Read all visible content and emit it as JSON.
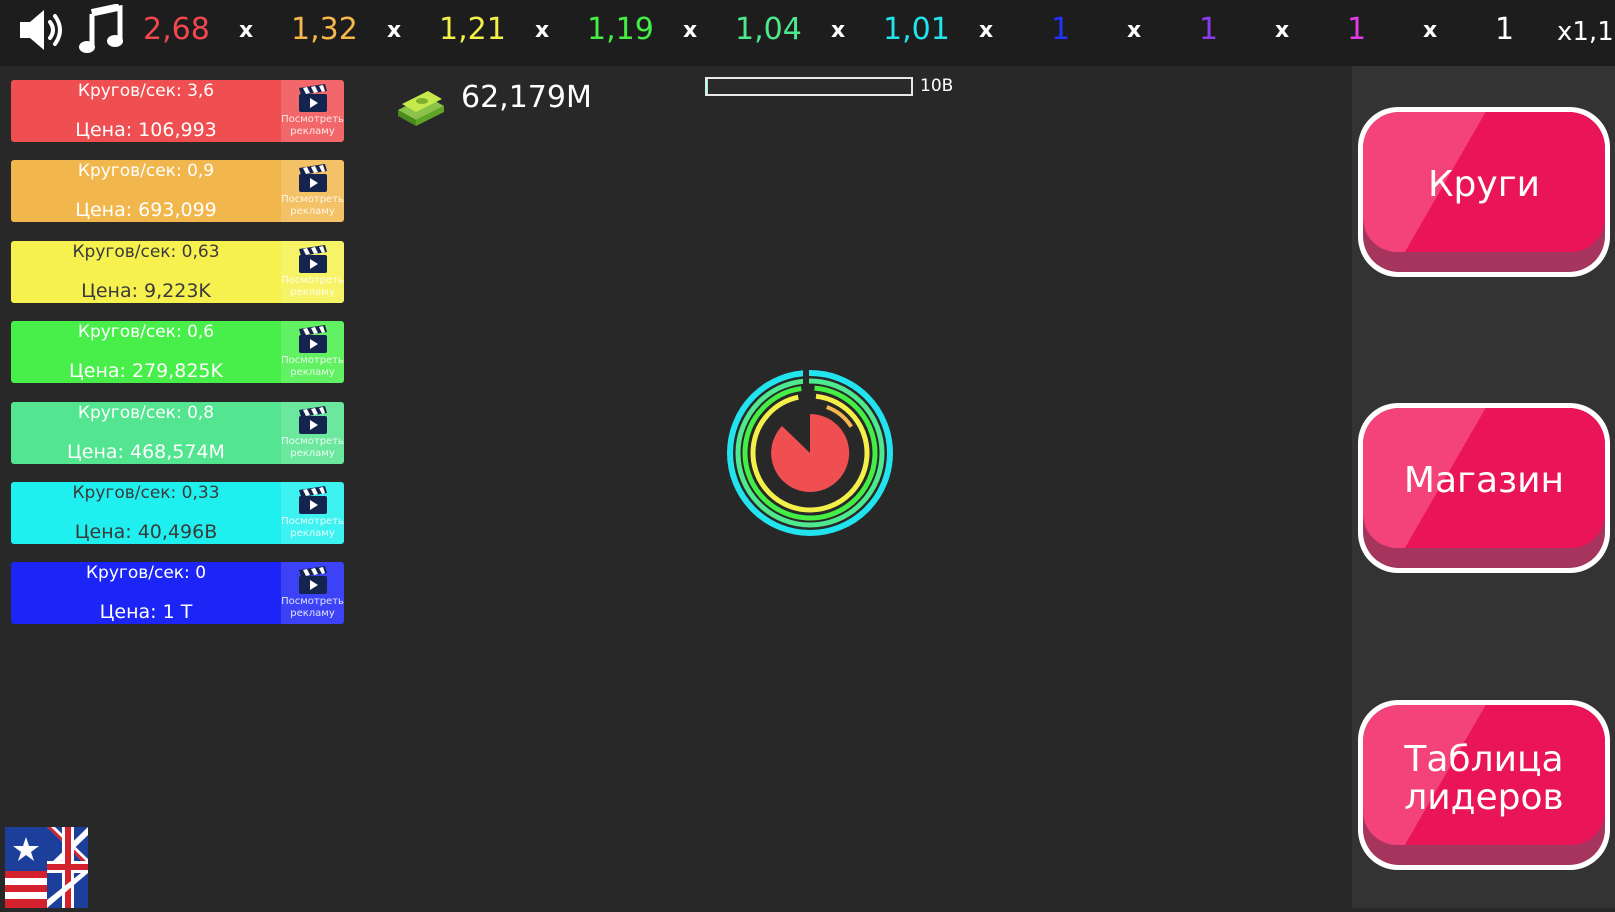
{
  "top_bar": {
    "sound_icon": "speaker-icon",
    "music_icon": "music-note-icon",
    "separator": "x",
    "multipliers": [
      {
        "value": "2,68",
        "color": "#f0484e"
      },
      {
        "value": "1,32",
        "color": "#f6b84c"
      },
      {
        "value": "1,21",
        "color": "#f4f04a"
      },
      {
        "value": "1,19",
        "color": "#44ee44"
      },
      {
        "value": "1,04",
        "color": "#4ee88e"
      },
      {
        "value": "1,01",
        "color": "#22e4ee"
      },
      {
        "value": "1",
        "color": "#2233ff"
      },
      {
        "value": "1",
        "color": "#8a3cf0"
      },
      {
        "value": "1",
        "color": "#e23ce6"
      },
      {
        "value": "1",
        "color": "#ffffff"
      }
    ],
    "total": "x1,1"
  },
  "upgrades": [
    {
      "speed": "Кругов/сек: 3,6",
      "price": "Цена: 106,993",
      "color": "#f04f51",
      "text_color": "#ffffff"
    },
    {
      "speed": "Кругов/сек: 0,9",
      "price": "Цена: 693,099",
      "color": "#f1b74d",
      "text_color": "#ffffff"
    },
    {
      "speed": "Кругов/сек: 0,63",
      "price": "Цена: 9,223K",
      "color": "#f6f14e",
      "text_color": "#3a3a3a"
    },
    {
      "speed": "Кругов/сек: 0,6",
      "price": "Цена: 279,825K",
      "color": "#48ef4a",
      "text_color": "#ffffff"
    },
    {
      "speed": "Кругов/сек: 0,8",
      "price": "Цена: 468,574M",
      "color": "#53e58f",
      "text_color": "#ffffff"
    },
    {
      "speed": "Кругов/сек: 0,33",
      "price": "Цена: 40,496B",
      "color": "#1ff0ef",
      "text_color": "#3a3a3a"
    },
    {
      "speed": "Кругов/сек: 0",
      "price": "Цена: 1 T",
      "color": "#1c25f6",
      "text_color": "#ffffff"
    }
  ],
  "ad_label": "Посмотреть рекламу",
  "ad_icon": "clapperboard-icon",
  "money": {
    "icon": "cash-stack-icon",
    "value": "62,179M"
  },
  "progress": {
    "goal": "10B",
    "fraction": 0.006
  },
  "menu": [
    {
      "label": "Круги"
    },
    {
      "label": "Магазин"
    },
    {
      "label_line1": "Таблица",
      "label_line2": "лидеров"
    }
  ],
  "language_icon": "us-uk-flag-icon",
  "colors": {
    "background": "#282828",
    "top_bar": "#1d1d1d",
    "right_panel": "#333333",
    "menu_button": "#ea1459"
  }
}
